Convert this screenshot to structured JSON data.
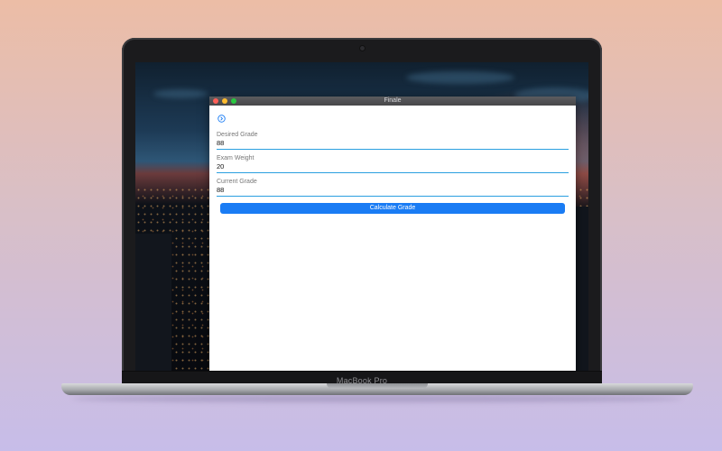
{
  "device": {
    "brand_label": "MacBook Pro"
  },
  "window": {
    "title": "Finale"
  },
  "form": {
    "fields": [
      {
        "label": "Desired Grade",
        "value": "88"
      },
      {
        "label": "Exam Weight",
        "value": "20"
      },
      {
        "label": "Current Grade",
        "value": "88"
      }
    ],
    "submit_label": "Calculate Grade"
  },
  "icons": {
    "back": "back-circle-icon"
  },
  "colors": {
    "accent": "#1a7cf4",
    "underline": "#2a9fe0"
  }
}
